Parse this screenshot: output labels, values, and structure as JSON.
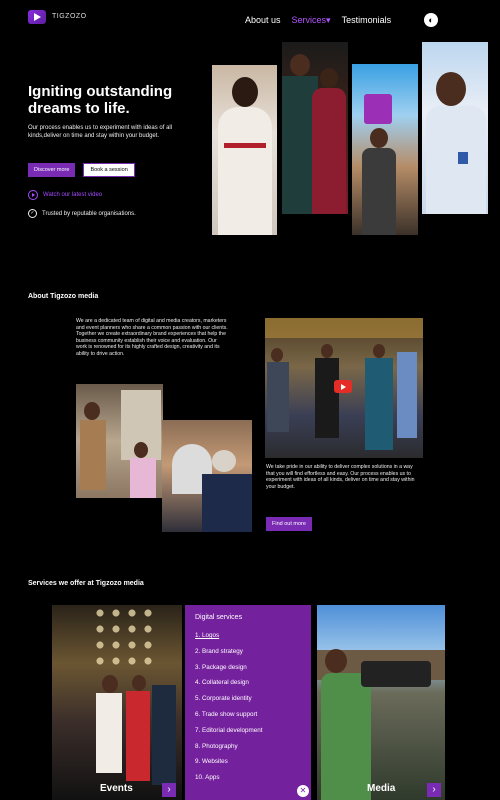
{
  "header": {
    "logo_text": "TIGZOZO",
    "nav": [
      {
        "label": "About us",
        "active": false
      },
      {
        "label": "Services",
        "active": true
      },
      {
        "label": "Testimonials",
        "active": false
      }
    ],
    "toggle_icon": "theme-toggle-icon"
  },
  "hero": {
    "title": "Igniting outstanding dreams to life.",
    "description": "Our process enables us to experiment with ideas of all kinds,deliver on time and stay within your budget.",
    "primary_button": "Discover more",
    "secondary_button": "Book a session",
    "watch_link": "Watch our latest video",
    "trusted_text": "Trusted by reputable organisations."
  },
  "about": {
    "heading": "About Tigzozo media",
    "paragraph1": "We are a dedicated team of digital and media creators, marketers and event planners who share a common passion with our clients. Together we create extraordinary brand experiences that help the business community establish their voice and evaluation. Our work is renowned for its highly crafted design, creativity and its ability to drive action.",
    "paragraph2": "We take pride in our ability to deliver complex solutions in a way that you will find effortless and easy. Our process enables us to experiment with ideas of all kinds, deliver on time and stay within your budget.",
    "button": "Find out more"
  },
  "services": {
    "heading": "Services we offer at Tigzozo media",
    "left_label": "Events",
    "right_label": "Media",
    "digital_title": "Digital services",
    "digital_items": [
      "1. Logos",
      "2. Brand strategy",
      "3. Package design",
      "4. Collateral design",
      "5. Corporate identity",
      "6. Trade show support",
      "7. Editorial development",
      "8. Photography",
      "9. Websites",
      "10. Apps"
    ]
  },
  "colors": {
    "accent": "#7a2bb3",
    "background": "#000000",
    "panel": "#74219d"
  }
}
